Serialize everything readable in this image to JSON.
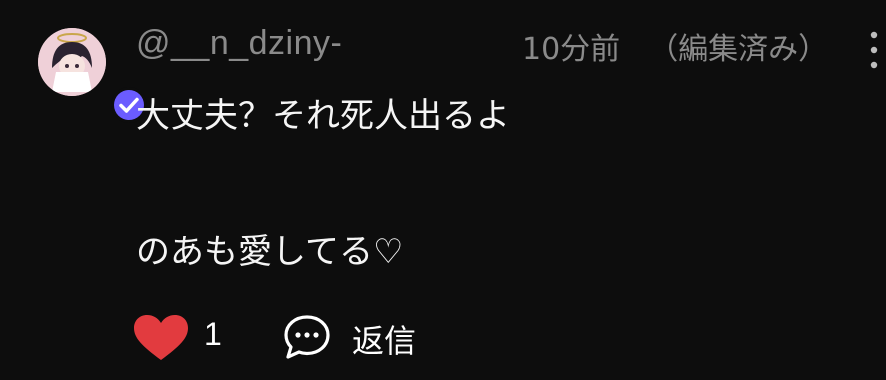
{
  "comment": {
    "username": "@__n_dziny-",
    "time": "10分前",
    "edited": "（編集済み）",
    "body_lines": [
      "大丈夫？それ死人出るよ",
      "のあも愛してる♡"
    ],
    "like_count": "1",
    "reply_label": "返信",
    "liked": true
  },
  "icons": {
    "avatar": "avatar-angel-character",
    "verified": "verified-badge-icon",
    "more": "more-vertical-icon",
    "like": "heart-icon",
    "reply": "speech-bubble-icon"
  },
  "colors": {
    "background": "#0d0d0d",
    "muted_text": "#8a8a8a",
    "text": "#f5f5f5",
    "heart": "#e23b3f",
    "verified_badge": "#6b5cff"
  }
}
